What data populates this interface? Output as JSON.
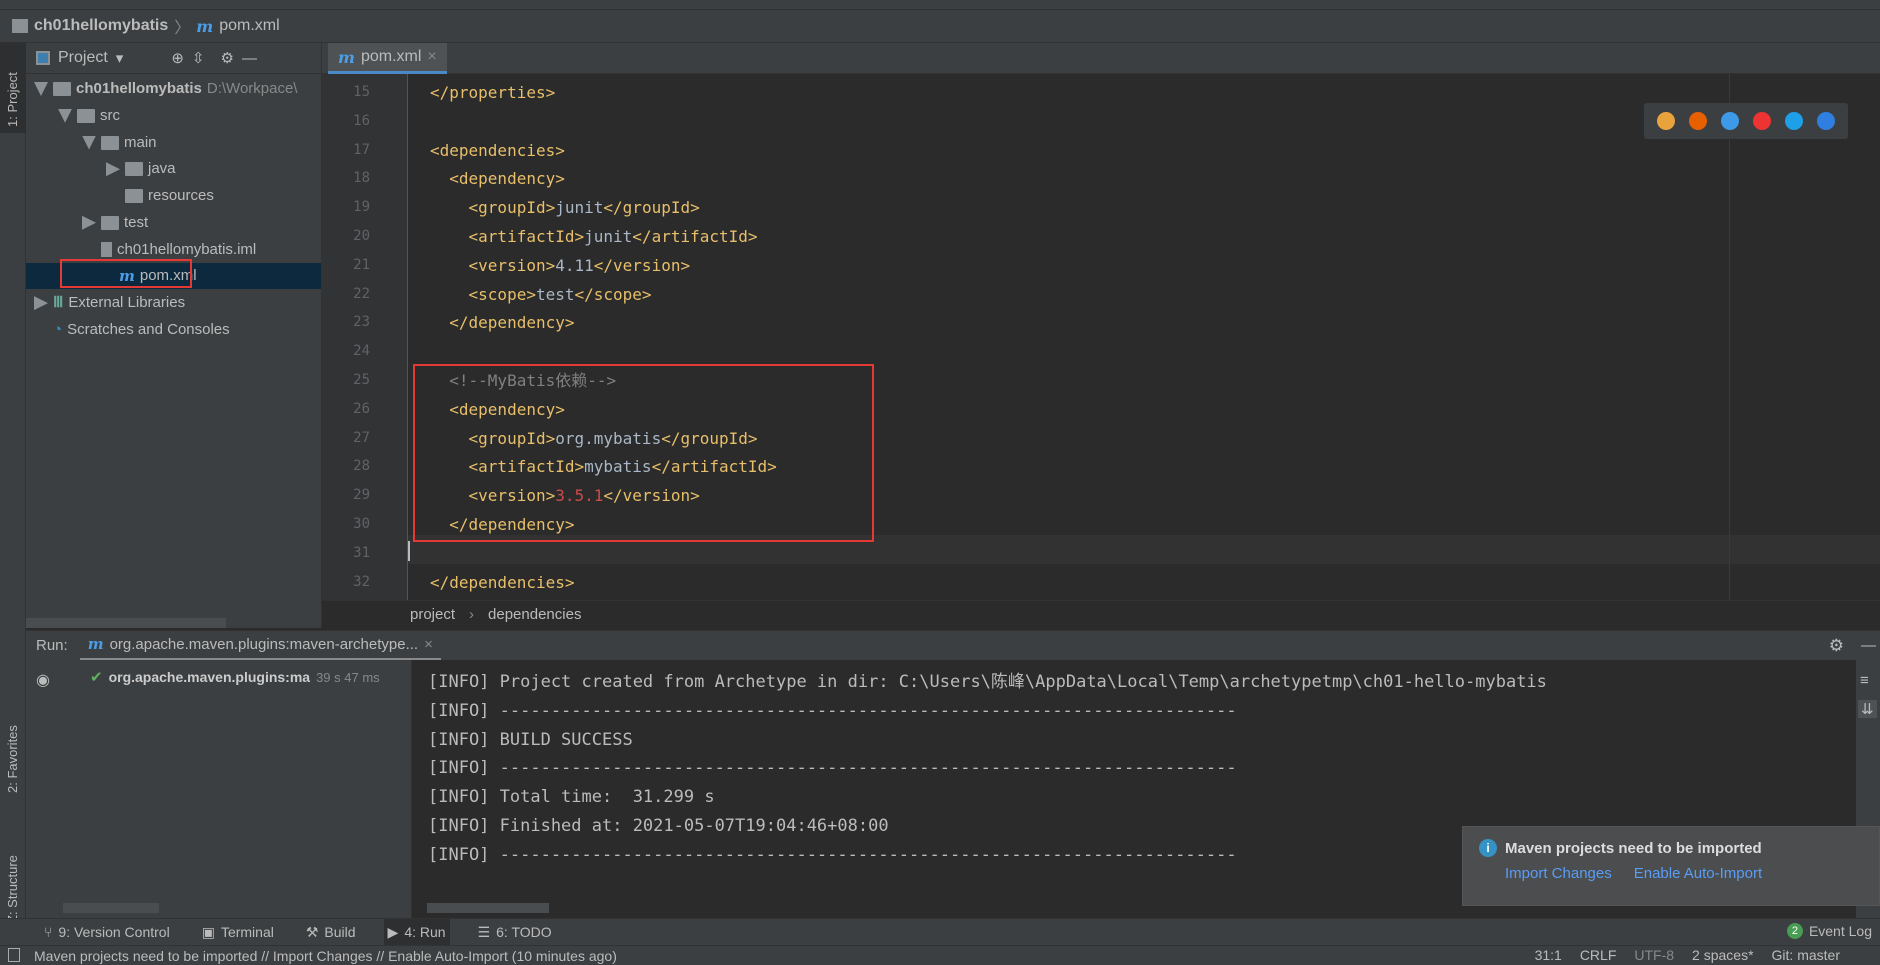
{
  "navbar": {
    "project": "ch01hellomybatis",
    "file": "pom.xml"
  },
  "left_stripe": {
    "project": "1: Project",
    "favorites": "2: Favorites",
    "structure": "Z: Structure"
  },
  "project_panel": {
    "title": "Project",
    "tree": [
      {
        "label": "ch01hellomybatis",
        "path": "D:\\Workpace\\",
        "depth": 0,
        "expanded": true
      },
      {
        "label": "src",
        "depth": 1,
        "expanded": true
      },
      {
        "label": "main",
        "depth": 2,
        "expanded": true
      },
      {
        "label": "java",
        "depth": 3,
        "expanded": false
      },
      {
        "label": "resources",
        "depth": 3
      },
      {
        "label": "test",
        "depth": 2,
        "expanded": false
      },
      {
        "label": "ch01hellomybatis.iml",
        "depth": 2
      },
      {
        "label": "pom.xml",
        "depth": 2,
        "selected": true
      },
      {
        "label": "External Libraries",
        "depth": 0,
        "expanded": false
      },
      {
        "label": "Scratches and Consoles",
        "depth": 0
      }
    ]
  },
  "editor": {
    "tab": "pom.xml",
    "lines": [
      {
        "n": "15",
        "code": "</properties>"
      },
      {
        "n": "16",
        "code": ""
      },
      {
        "n": "17",
        "code": "<dependencies>"
      },
      {
        "n": "18",
        "code": "  <dependency>"
      },
      {
        "n": "19",
        "code": "    <groupId>junit</groupId>"
      },
      {
        "n": "20",
        "code": "    <artifactId>junit</artifactId>"
      },
      {
        "n": "21",
        "code": "    <version>4.11</version>"
      },
      {
        "n": "22",
        "code": "    <scope>test</scope>"
      },
      {
        "n": "23",
        "code": "  </dependency>"
      },
      {
        "n": "24",
        "code": ""
      },
      {
        "n": "25",
        "code": "  <!--MyBatis依赖-->"
      },
      {
        "n": "26",
        "code": "  <dependency>"
      },
      {
        "n": "27",
        "code": "    <groupId>org.mybatis</groupId>"
      },
      {
        "n": "28",
        "code": "    <artifactId>mybatis</artifactId>"
      },
      {
        "n": "29",
        "code": "    <version>3.5.1</version>"
      },
      {
        "n": "30",
        "code": "  </dependency>"
      },
      {
        "n": "31",
        "code": ""
      },
      {
        "n": "32",
        "code": "</dependencies>"
      }
    ],
    "breadcrumb": [
      "project",
      "dependencies"
    ],
    "browser_icons": [
      "chrome-icon",
      "firefox-icon",
      "safari-icon",
      "opera-icon",
      "ie-icon",
      "edge-icon"
    ]
  },
  "run": {
    "label": "Run:",
    "tab": "org.apache.maven.plugins:maven-archetype...",
    "tree_item": "org.apache.maven.plugins:ma",
    "tree_time": "39 s 47 ms",
    "console": [
      "[INFO] Project created from Archetype in dir: C:\\Users\\陈峰\\AppData\\Local\\Temp\\archetypetmp\\ch01-hello-mybatis",
      "[INFO] ------------------------------------------------------------------------",
      "[INFO] BUILD SUCCESS",
      "[INFO] ------------------------------------------------------------------------",
      "[INFO] Total time:  31.299 s",
      "[INFO] Finished at: 2021-05-07T19:04:46+08:00",
      "[INFO] ------------------------------------------------------------------------"
    ]
  },
  "notification": {
    "title": "Maven projects need to be imported",
    "import": "Import Changes",
    "auto": "Enable Auto-Import"
  },
  "toolwindows": [
    "9: Version Control",
    "Terminal",
    "Build",
    "4: Run",
    "6: TODO"
  ],
  "event_log": {
    "count": "2",
    "label": "Event Log"
  },
  "status": {
    "message": "Maven projects need to be imported // Import Changes // Enable Auto-Import (10 minutes ago)",
    "position": "31:1",
    "line_sep": "CRLF",
    "encoding": "UTF-8",
    "indent": "2 spaces*",
    "vcs": "Git: master"
  },
  "colors": {
    "tag": "#e8bf6a",
    "text": "#a9b7c6",
    "comment": "#808080",
    "highlight_box": "#e53935",
    "link": "#589df6"
  }
}
